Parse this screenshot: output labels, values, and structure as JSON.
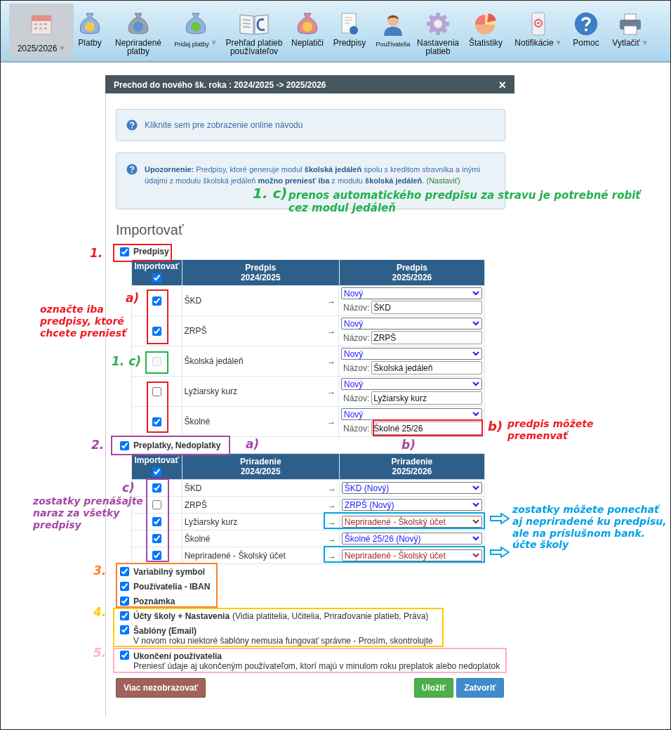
{
  "toolbar": {
    "items": [
      {
        "label": "2025/2026",
        "selected": true,
        "caret": "▼",
        "compact": false
      },
      {
        "label": "Platby",
        "selected": false,
        "compact": false
      },
      {
        "label": "Nepriradené platby",
        "selected": false,
        "compact": false
      },
      {
        "label": "Pridaj platby",
        "selected": false,
        "caret": "▼",
        "compact": true
      },
      {
        "label": "Prehľad platieb používateľov",
        "selected": false,
        "compact": false
      },
      {
        "label": "Neplatiči",
        "selected": false,
        "compact": false
      },
      {
        "label": "Predpisy",
        "selected": false,
        "compact": false
      },
      {
        "label": "Používatelia",
        "selected": false,
        "compact": true
      },
      {
        "label": "Nastavenia platieb",
        "selected": false,
        "compact": false
      },
      {
        "label": "Štatistiky",
        "selected": false,
        "compact": false
      },
      {
        "label": "Notifikácie",
        "selected": false,
        "caret": "▼",
        "compact": false
      },
      {
        "label": "Pomoc",
        "selected": false,
        "compact": false
      },
      {
        "label": "Vytlačiť",
        "selected": false,
        "caret": "▼",
        "compact": false
      }
    ]
  },
  "dialog": {
    "title": "Prechod do nového šk. roka : 2024/2025 -> 2025/2026",
    "close": "×",
    "help_notice": "Kliknite sem pre zobrazenie online návodu",
    "warning": {
      "text": "**Upozornenie:** Predpisy, ktoré generuje modul **školská jedáleň** spolu s kreditom stravníka a inými údajmi z modulu školská jedáleň **možno preniesť iba** z modulu **školská jedáleň**.",
      "link": "(Nastaviť)"
    },
    "section_title": "Importovať",
    "predpisy": {
      "label": "Predpisy",
      "checked": true,
      "header_checked": true,
      "columns": [
        "Importovať",
        "Predpis\n2024/2025",
        "Predpis\n2025/2026"
      ],
      "rows": [
        {
          "name": "ŠKD",
          "checked": true,
          "disabled": false,
          "arrow": "→",
          "select": "Nový",
          "name_label": "Názov:",
          "new_name": "ŠKD"
        },
        {
          "name": "ZRPŠ",
          "checked": true,
          "disabled": false,
          "arrow": "→",
          "select": "Nový",
          "name_label": "Názov:",
          "new_name": "ZRPŠ"
        },
        {
          "name": "Školská jedáleň",
          "checked": false,
          "disabled": true,
          "arrow": "→",
          "select": "Nový",
          "name_label": "Názov:",
          "new_name": "Školská jedáleň"
        },
        {
          "name": "Lyžiarsky kurz",
          "checked": false,
          "disabled": false,
          "arrow": "→",
          "select": "Nový",
          "name_label": "Názov:",
          "new_name": "Lyžiarsky kurz"
        },
        {
          "name": "Školné",
          "checked": true,
          "disabled": false,
          "arrow": "→",
          "select": "Nový",
          "name_label": "Názov:",
          "new_name": "Školné 25/26"
        }
      ]
    },
    "balances": {
      "label": "Preplatky, Nedoplatky",
      "checked": true,
      "header_checked": true,
      "columns": [
        "Importovať",
        "Priradenie\n2024/2025",
        "Priradenie\n2025/2026"
      ],
      "rows": [
        {
          "name": "ŠKD",
          "checked": true,
          "arrow": "→",
          "select": "ŠKD (Nový)",
          "unassigned": false
        },
        {
          "name": "ZRPŠ",
          "checked": false,
          "arrow": "→",
          "select": "ZRPŠ (Nový)",
          "unassigned": false
        },
        {
          "name": "Lyžiarsky kurz",
          "checked": true,
          "arrow": "→",
          "select": "Nepriradené - Školský účet",
          "unassigned": true
        },
        {
          "name": "Školné",
          "checked": true,
          "arrow": "→",
          "select": "Školné 25/26 (Nový)",
          "unassigned": false
        },
        {
          "name": "Nepriradené - Školský účet",
          "checked": true,
          "arrow": "→",
          "select": "Nepriradené - Školský účet",
          "unassigned": true
        }
      ]
    },
    "options": [
      {
        "label": "Variabilný symbol",
        "checked": true
      },
      {
        "label": "Používatelia - IBAN",
        "checked": true
      },
      {
        "label": "Poznámka",
        "checked": true
      },
      {
        "label": "Účty školy + Nastavenia",
        "detail": "(Vidia platitelia, Učitelia, Priraďovanie platieb, Práva)",
        "checked": true
      },
      {
        "label": "Šablóny (Email)",
        "note": "V novom roku niektoré šablóny nemusia fungovať správne - Prosím, skontrolujte",
        "checked": true
      },
      {
        "label": "Ukončení používatelia",
        "note": "Preniesť údaje aj ukončeným používateľom, ktorí majú v minulom roku preplatok alebo nedoplatok",
        "checked": true
      }
    ],
    "buttons": [
      {
        "label": "Viac nezobrazovať",
        "kind": "danger"
      },
      {
        "label": "Uložiť",
        "kind": "success"
      },
      {
        "label": "Zatvoriť",
        "kind": "primary"
      }
    ]
  },
  "annotations": [
    {
      "text": "1. c)",
      "color": "#22b14c"
    },
    {
      "text": "prenos automatického predpisu za stravu je potrebné robiť cez modul jedáleň",
      "color": "#22b14c"
    },
    {
      "text": "1.",
      "color": "#ed1c24"
    },
    {
      "text": "a)",
      "color": "#ed1c24"
    },
    {
      "text": "označte iba predpisy, ktoré chcete preniesť",
      "color": "#ed1c24"
    },
    {
      "text": "1. c)",
      "color": "#22b14c"
    },
    {
      "text": "b)",
      "color": "#ed1c24"
    },
    {
      "text": "predpis môžete premenvať",
      "color": "#ed1c24"
    },
    {
      "text": "2.",
      "color": "#a349a4"
    },
    {
      "text": "a)",
      "color": "#a349a4"
    },
    {
      "text": "b)",
      "color": "#a349a4"
    },
    {
      "text": "c)",
      "color": "#a349a4"
    },
    {
      "text": "zostatky prenášajte naraz za všetky predpisy",
      "color": "#a349a4"
    },
    {
      "text": "zostatky môžete ponechať aj nepriradené ku predpisu, ale na príslušnom bank. účte školy",
      "color": "#00a2e8"
    },
    {
      "text": "3.",
      "color": "#ff7f27"
    },
    {
      "text": "4.",
      "color": "#ffc90e"
    },
    {
      "text": "5.",
      "color": "#ffaec9"
    }
  ]
}
